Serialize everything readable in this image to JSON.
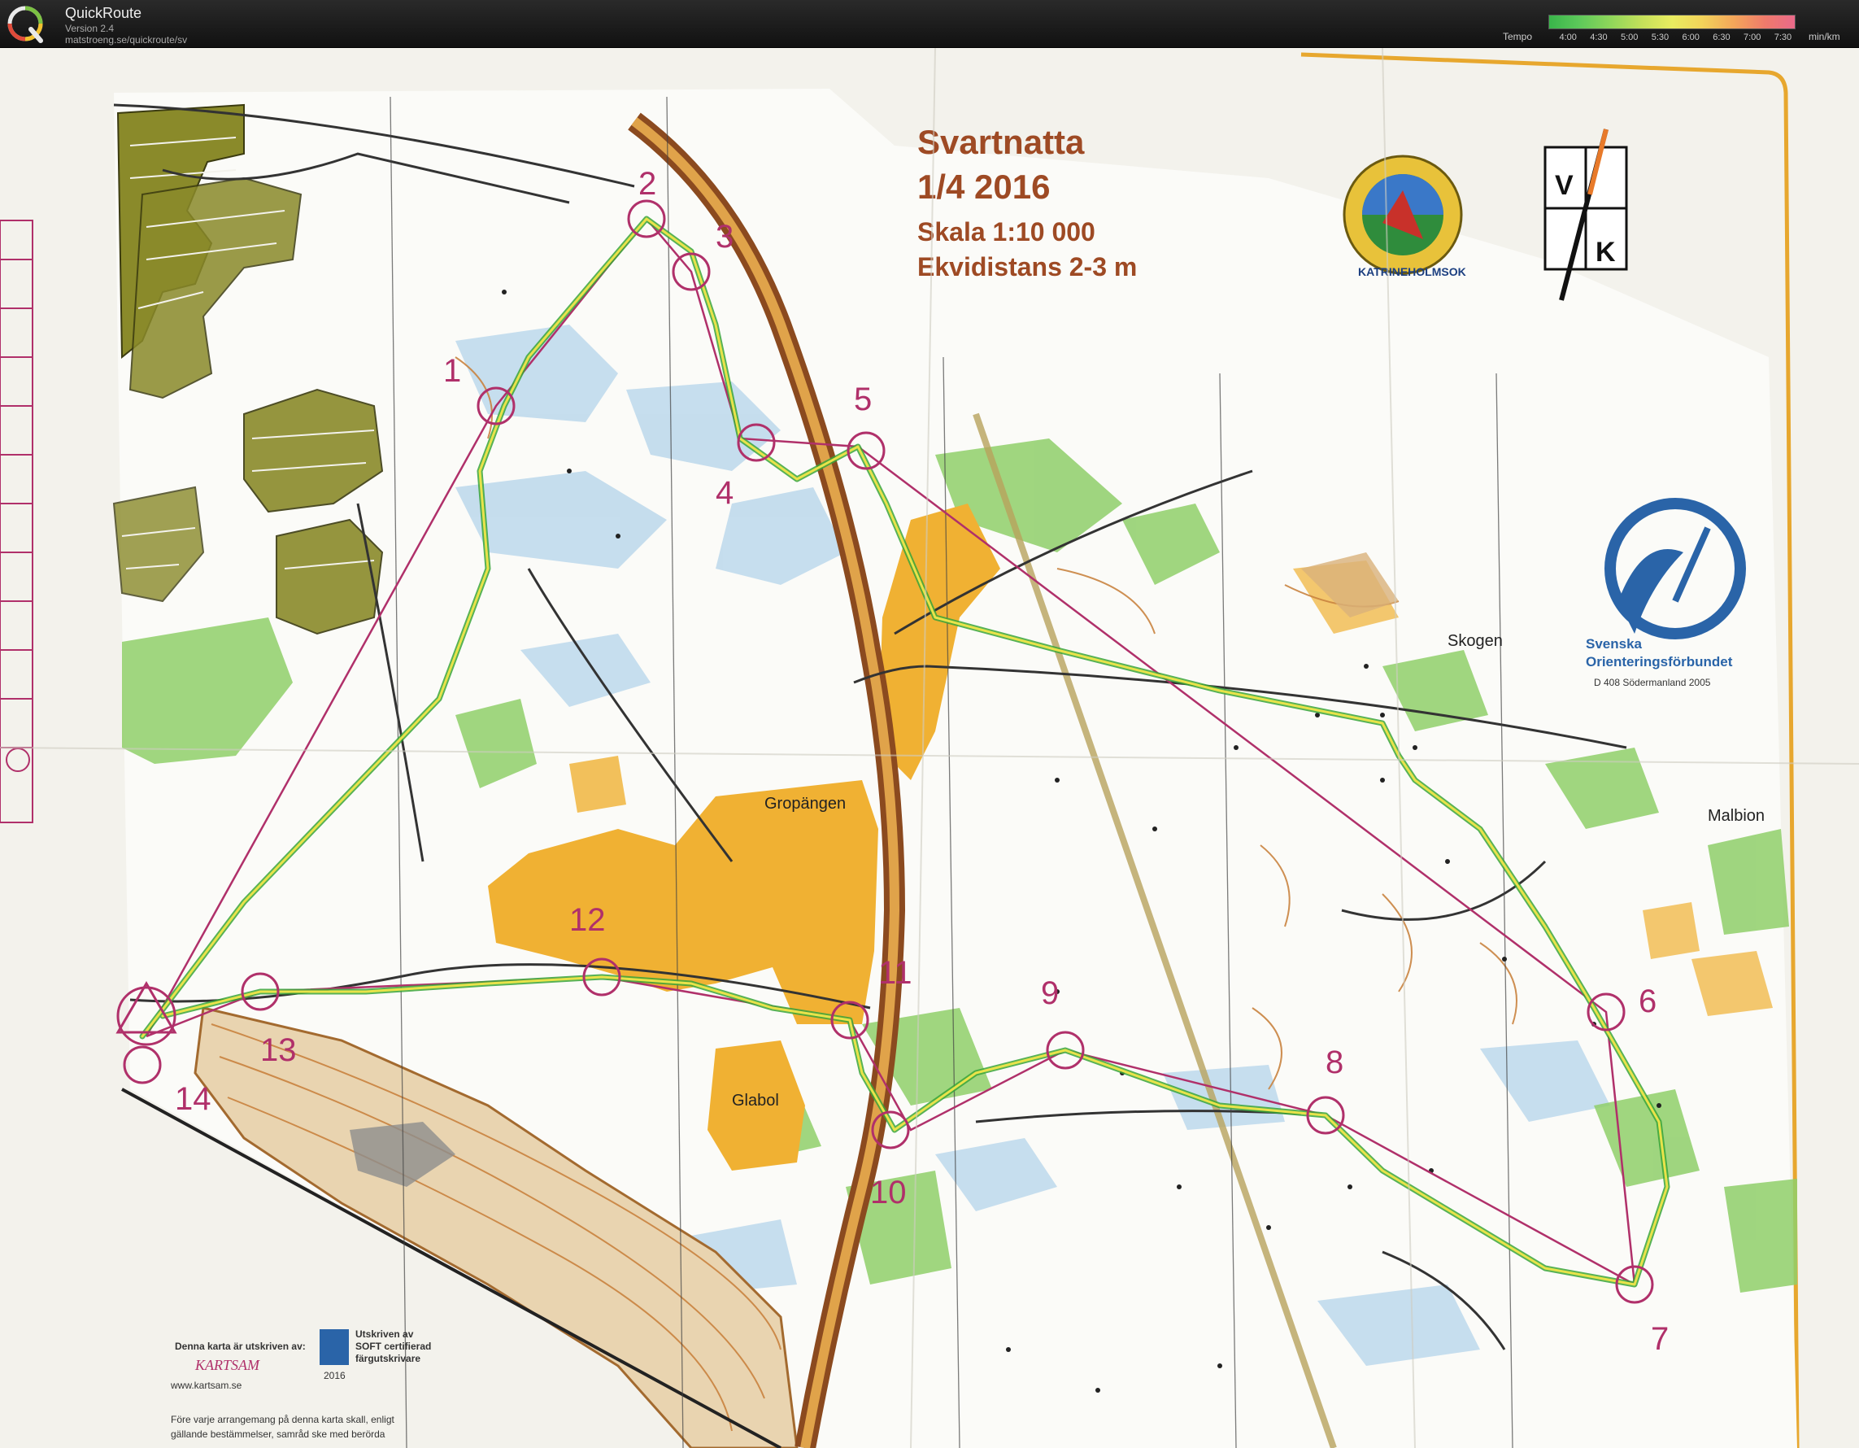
{
  "app": {
    "title": "QuickRoute",
    "version": "Version 2.4",
    "url": "matstroeng.se/quickroute/sv"
  },
  "tempo": {
    "label": "Tempo",
    "ticks": [
      "4:00",
      "4:30",
      "5:00",
      "5:30",
      "6:00",
      "6:30",
      "7:00",
      "7:30"
    ],
    "unit": "min/km"
  },
  "map": {
    "title": "Svartnatta",
    "date": "1/4 2016",
    "scale": "Skala 1:10 000",
    "contour": "Ekvidistans 2-3 m",
    "places": [
      "Gropängen",
      "Glabol",
      "Skogen",
      "Malbion"
    ],
    "controls": [
      "1",
      "2",
      "3",
      "4",
      "5",
      "6",
      "7",
      "8",
      "9",
      "10",
      "11",
      "12",
      "13",
      "14"
    ],
    "logos": {
      "club": "KATRINEHOLMSOK",
      "vk_letters": [
        "V",
        "K"
      ],
      "federation_line1": "Svenska",
      "federation_line2": "Orienteringsförbundet",
      "federation_code": "D 408  Södermanland  2005"
    },
    "print_notes": {
      "printed_by": "Denna karta är utskriven av:",
      "printer_name": "KARTSAM",
      "printer_url": "www.kartsam.se",
      "cert_line1": "Utskriven av",
      "cert_line2": "SOFT certifierad",
      "cert_line3": "färgutskrivare",
      "cert_year": "2016",
      "rules_line1": "Före varje arrangemang på denna karta skall, enligt",
      "rules_line2": "gällande bestämmelser, samråd ske med berörda"
    }
  },
  "colors": {
    "paper": "#f4f3ee",
    "forest_green": "#8fcf6a",
    "yellow_open": "#f0b133",
    "settlement": "#8a8a2a",
    "marsh_blue": "#bcd8ec",
    "course_magenta": "#b0306a",
    "contour_brown": "#c9833f",
    "title_brown": "#9e4a24",
    "federation_blue": "#2a64a8"
  }
}
